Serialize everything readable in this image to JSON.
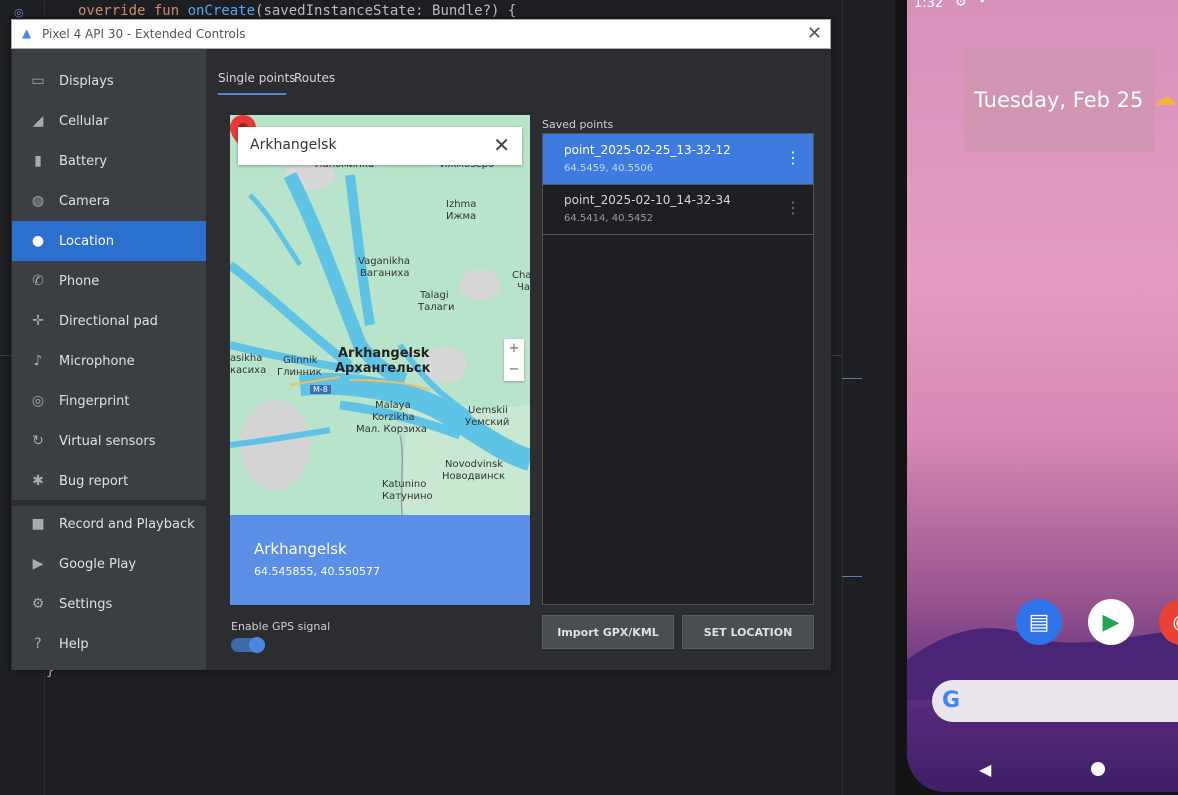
{
  "ide": {
    "code_line_kw": "override fun ",
    "code_line_fn": "onCreate",
    "code_line_rest": "(savedInstanceState: Bundle?) {",
    "closing_brace": "}"
  },
  "phone": {
    "status_time": "1:32",
    "date_text": "Tuesday, Feb 25",
    "search_logo": "G"
  },
  "window": {
    "title": "Pixel 4 API 30 - Extended Controls"
  },
  "sidebar": {
    "items": [
      {
        "label": "Displays",
        "icon": "display-icon"
      },
      {
        "label": "Cellular",
        "icon": "signal-icon"
      },
      {
        "label": "Battery",
        "icon": "battery-icon"
      },
      {
        "label": "Camera",
        "icon": "camera-icon"
      },
      {
        "label": "Location",
        "icon": "location-icon"
      },
      {
        "label": "Phone",
        "icon": "phone-icon"
      },
      {
        "label": "Directional pad",
        "icon": "dpad-icon"
      },
      {
        "label": "Microphone",
        "icon": "microphone-icon"
      },
      {
        "label": "Fingerprint",
        "icon": "fingerprint-icon"
      },
      {
        "label": "Virtual sensors",
        "icon": "sensors-icon"
      },
      {
        "label": "Bug report",
        "icon": "bug-icon"
      },
      {
        "label": "Record and Playback",
        "icon": "video-icon"
      },
      {
        "label": "Google Play",
        "icon": "play-icon"
      },
      {
        "label": "Settings",
        "icon": "gear-icon"
      },
      {
        "label": "Help",
        "icon": "help-icon"
      }
    ],
    "active": "Location"
  },
  "tabs": [
    {
      "label": "Single points"
    },
    {
      "label": "Routes"
    }
  ],
  "map": {
    "search_query": "Arkhangelsk",
    "zoom_in": "+",
    "zoom_out": "−",
    "road_badge": "M-8",
    "labels": {
      "lapominka": "Лапоминка",
      "izhmozero": "Ижмозеро",
      "izhma_en": "Izhma",
      "izhma_ru": "Ижма",
      "vaganikha_en": "Vaganikha",
      "vaganikha_ru": "Ваганиха",
      "talagi_en": "Talagi",
      "talagi_ru": "Талаги",
      "cha_en": "Cha",
      "cha_ru": "Ча",
      "arkh_en": "Arkhangelsk",
      "arkh_ru": "Архангельск",
      "kasikha_en": "asikha",
      "kasikha_ru": "касиха",
      "glinnik_en": "Glinnik",
      "glinnik_ru": "Глинник",
      "malaya_en": "Malaya",
      "korzikha_en": "Korzikha",
      "korzikha_ru": "Мал. Корзиха",
      "uemskii_en": "Uemskii",
      "uemskii_ru": "Уемский",
      "novodvinsk_en": "Novodvinsk",
      "novodvinsk_ru": "Новодвинск",
      "katunino_en": "Katunino",
      "katunino_ru": "Катунино"
    }
  },
  "location": {
    "name": "Arkhangelsk",
    "coords": "64.545855, 40.550577"
  },
  "gps": {
    "label": "Enable GPS signal",
    "enabled": true
  },
  "saved": {
    "label": "Saved points",
    "points": [
      {
        "name": "point_2025-02-25_13-32-12",
        "coords": "64.5459, 40.5506",
        "selected": true
      },
      {
        "name": "point_2025-02-10_14-32-34",
        "coords": "64.5414, 40.5452",
        "selected": false
      }
    ]
  },
  "buttons": {
    "import": "Import GPX/KML",
    "set_location": "SET LOCATION"
  },
  "colors": {
    "accent": "#2b6fcf",
    "location_panel": "#5b8ee6",
    "selected_row": "#3d7be0",
    "pin": "#e53935"
  }
}
